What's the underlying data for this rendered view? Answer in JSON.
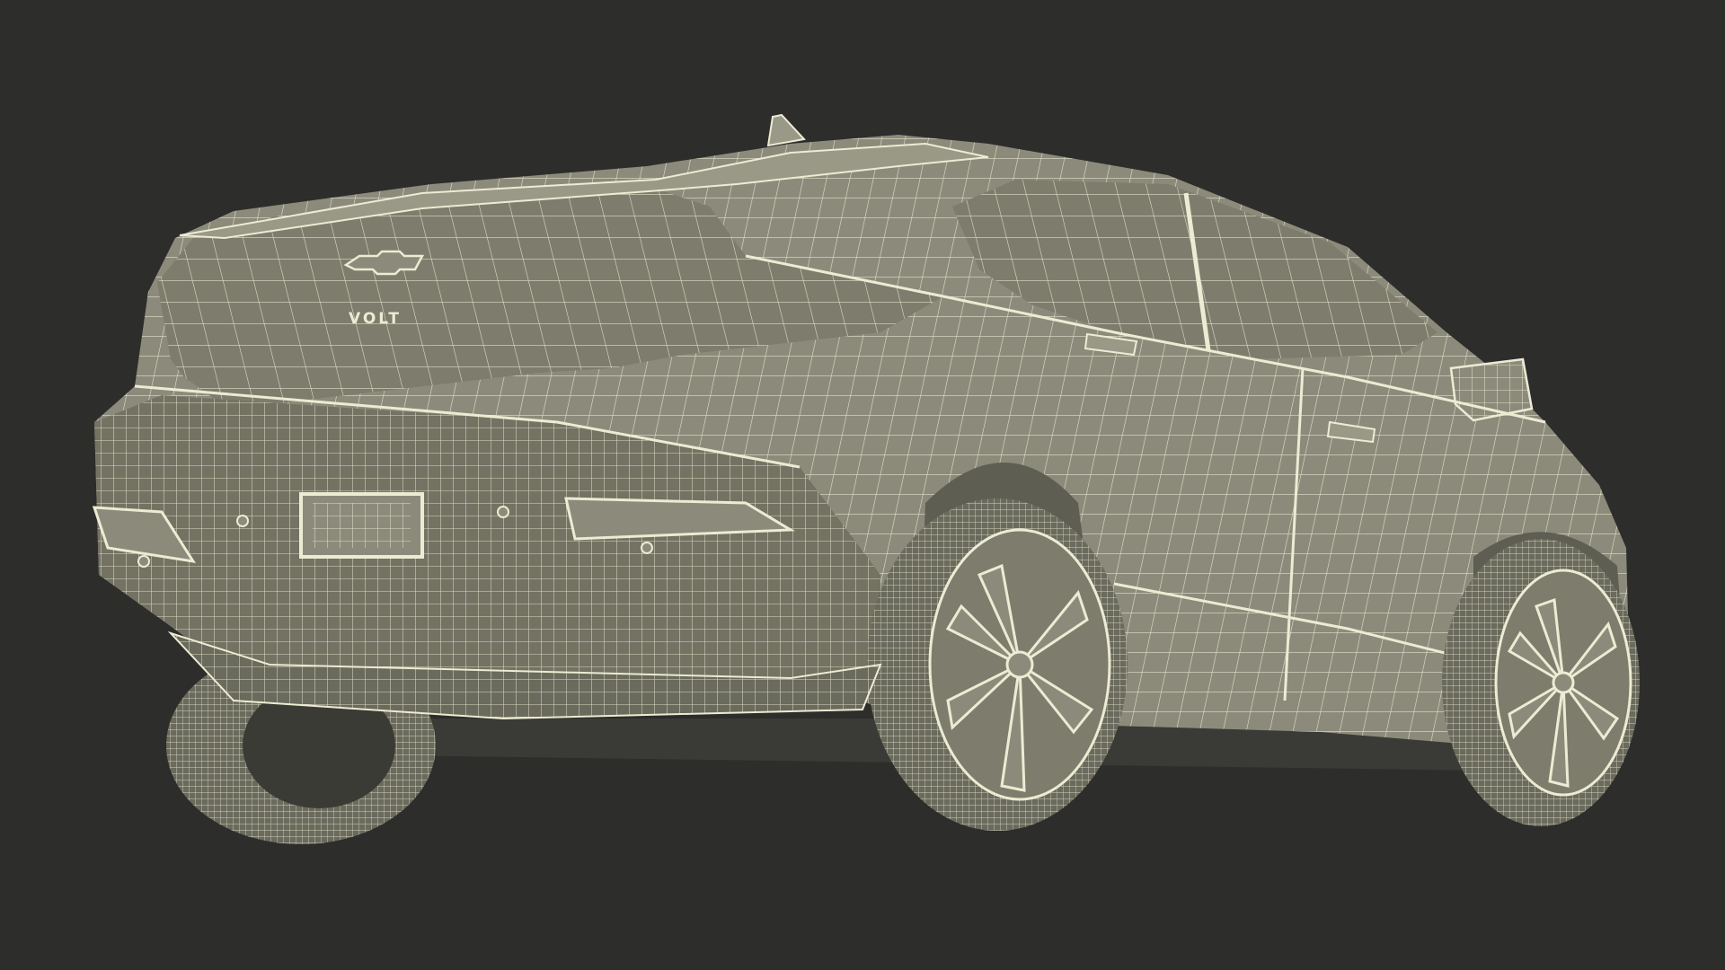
{
  "scene": {
    "background_color": "#2d2d2b",
    "body_color": "#8c8b7b",
    "body_shade_color": "#737263",
    "glass_color": "#7d7c6d",
    "tire_color": "#6a6a5d",
    "mesh_color": "#ecebd3"
  },
  "car": {
    "rear_badge": "VOLT",
    "emblem_icon": "bowtie-emblem-icon"
  }
}
